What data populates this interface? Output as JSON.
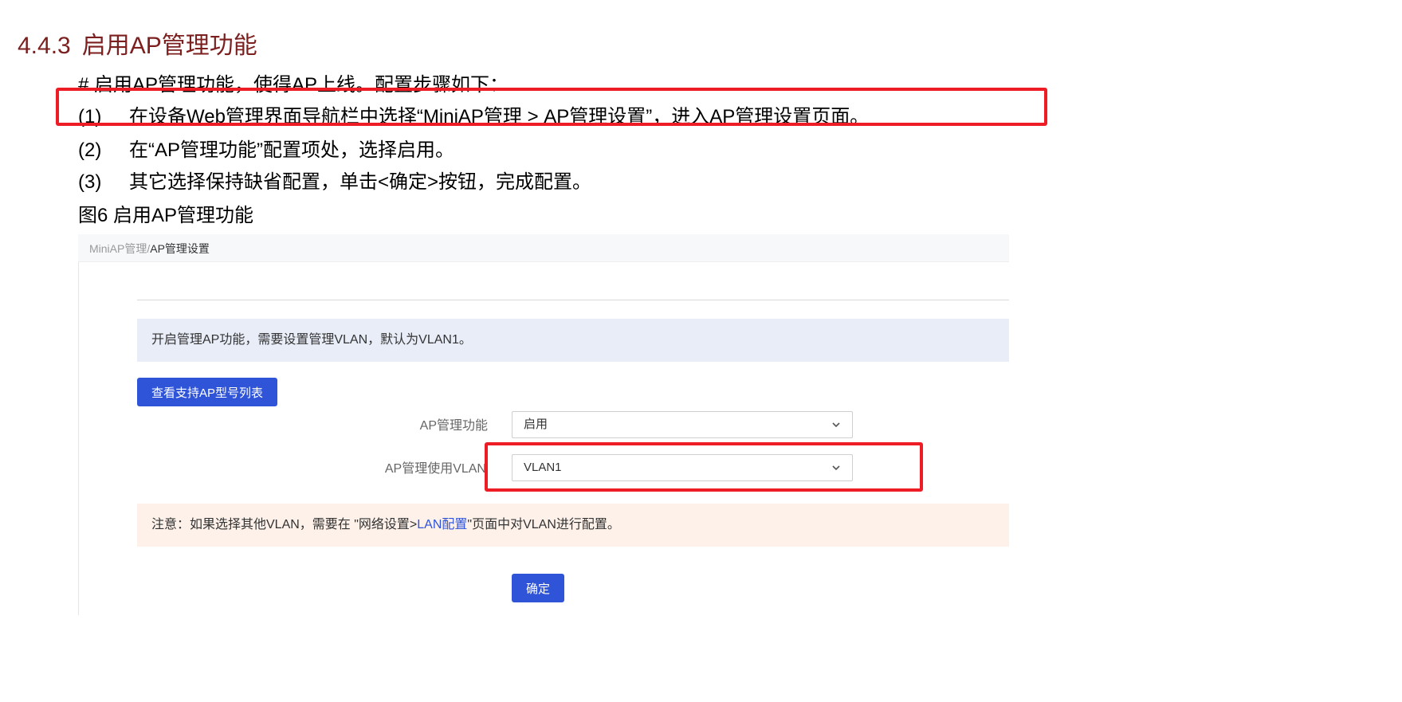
{
  "doc": {
    "section_number": "4.4.3",
    "section_title": "启用AP管理功能",
    "intro": "# 启用AP管理功能，使得AP上线。配置步骤如下：",
    "steps": [
      {
        "index": "(1)",
        "text": "在设备Web管理界面导航栏中选择“MiniAP管理 > AP管理设置”，进入AP管理设置页面。"
      },
      {
        "index": "(2)",
        "text": "在“AP管理功能”配置项处，选择启用。"
      },
      {
        "index": "(3)",
        "text": "其它选择保持缺省配置，单击<确定>按钮，完成配置。"
      }
    ],
    "figure_caption": "图6 启用AP管理功能"
  },
  "screenshot": {
    "breadcrumb": {
      "parent": "MiniAP管理",
      "separator": "/",
      "current": "AP管理设置"
    },
    "info_text": "开启管理AP功能，需要设置管理VLAN，默认为VLAN1。",
    "list_button": "查看支持AP型号列表",
    "fields": {
      "ap_mgmt_label": "AP管理功能",
      "ap_mgmt_value": "启用",
      "vlan_label": "AP管理使用VLAN",
      "vlan_value": "VLAN1"
    },
    "note": {
      "prefix": "注意：如果选择其他VLAN，需要在 \"网络设置>",
      "link": "LAN配置",
      "suffix": "\"页面中对VLAN进行配置。"
    },
    "ok_button": "确定"
  },
  "colors": {
    "section_title": "#7b1f1f",
    "highlight_box": "#ee1c24",
    "primary_button": "#2f54d8",
    "info_background": "#e8edf8",
    "note_background": "#fdf1ea"
  },
  "icons": {
    "select_arrow": "chevron-down-icon"
  }
}
